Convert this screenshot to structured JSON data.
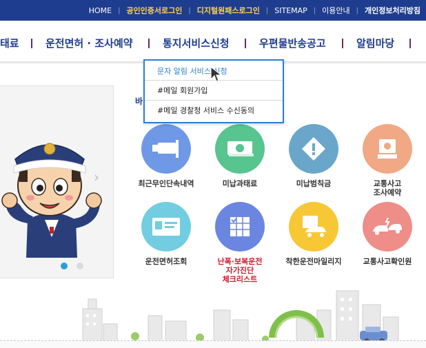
{
  "topbar": {
    "links": [
      "HOME",
      "공인인증서로그인",
      "디지털원패스로그인",
      "SITEMAP",
      "이용안내",
      "개인정보처리방침"
    ]
  },
  "nav": {
    "items": [
      "태료",
      "운전면허 · 조사예약",
      "통지서비스신청",
      "우편물반송공고",
      "알림마당"
    ]
  },
  "dropdown": {
    "items": [
      "문자 알림 서비스 신청",
      "#메일 회원가입",
      "#메일 경찰청 서비스 수신동의"
    ]
  },
  "section": {
    "title": "바"
  },
  "services": [
    {
      "label": "최근무인단속내역",
      "icon": "camera-icon",
      "color": "#6f98e6"
    },
    {
      "label": "미납과태료",
      "icon": "money-icon",
      "color": "#58c48f"
    },
    {
      "label": "미납범칙금",
      "icon": "warning-icon",
      "color": "#6aa6c9"
    },
    {
      "label": "교통사고\n조사예약",
      "icon": "kiosk-icon",
      "color": "#f1a884"
    },
    {
      "label": "운전면허조회",
      "icon": "license-card-icon",
      "color": "#72cde0"
    },
    {
      "label": "난폭·보복운전\n자가진단\n체크리스트",
      "icon": "checklist-icon",
      "color": "#6b86e0"
    },
    {
      "label": "착한운전마일리지",
      "icon": "mileage-car-icon",
      "color": "#f7c736"
    },
    {
      "label": "교통사고확인원",
      "icon": "car-crash-icon",
      "color": "#ef8d88"
    }
  ],
  "colors": {
    "topbar": "#1f3d8f",
    "nav_text": "#1f3d8f",
    "dropdown_border": "#2a7fd0",
    "highlight": "#ffd54a"
  }
}
